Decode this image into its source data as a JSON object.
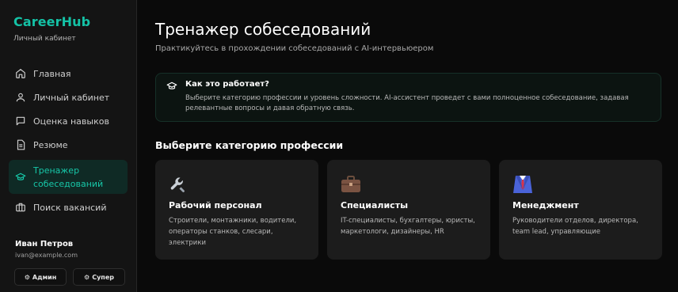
{
  "brand": {
    "title": "CareerHub",
    "subtitle": "Личный кабинет"
  },
  "sidebar": {
    "items": [
      {
        "label": "Главная",
        "icon": "home-icon"
      },
      {
        "label": "Личный кабинет",
        "icon": "user-icon"
      },
      {
        "label": "Оценка навыков",
        "icon": "chat-icon"
      },
      {
        "label": "Резюме",
        "icon": "document-icon"
      },
      {
        "label": "Тренажер собеседований",
        "icon": "graduation-cap-icon",
        "active": true
      },
      {
        "label": "Поиск вакансий",
        "icon": "briefcase-icon"
      }
    ]
  },
  "user": {
    "name": "Иван Петров",
    "email": "ivan@example.com"
  },
  "roles": {
    "admin": "Админ",
    "super": "Супер"
  },
  "main": {
    "title": "Тренажер собеседований",
    "subtitle": "Практикуйтесь в прохождении собеседований с AI-интервьюером",
    "info": {
      "title": "Как это работает?",
      "text": "Выберите категорию профессии и уровень сложности. AI-ассистент проведет с вами полноценное собеседование, задавая релевантные вопросы и давая обратную связь."
    },
    "section_title": "Выберите категорию профессии",
    "cards": [
      {
        "title": "Рабочий персонал",
        "desc": "Строители, монтажники, водители, операторы станков, слесари, электрики",
        "icon": "wrench-icon"
      },
      {
        "title": "Специалисты",
        "desc": "IT-специалисты, бухгалтеры, юристы, маркетологи, дизайнеры, HR",
        "icon": "briefcase-icon"
      },
      {
        "title": "Менеджмент",
        "desc": "Руководители отделов, директора, team lead, управляющие",
        "icon": "suit-icon"
      }
    ]
  },
  "colors": {
    "accent": "#14c2a6",
    "background": "#0a0a0a",
    "sidebar": "#141414",
    "card": "#1c1c1c"
  }
}
